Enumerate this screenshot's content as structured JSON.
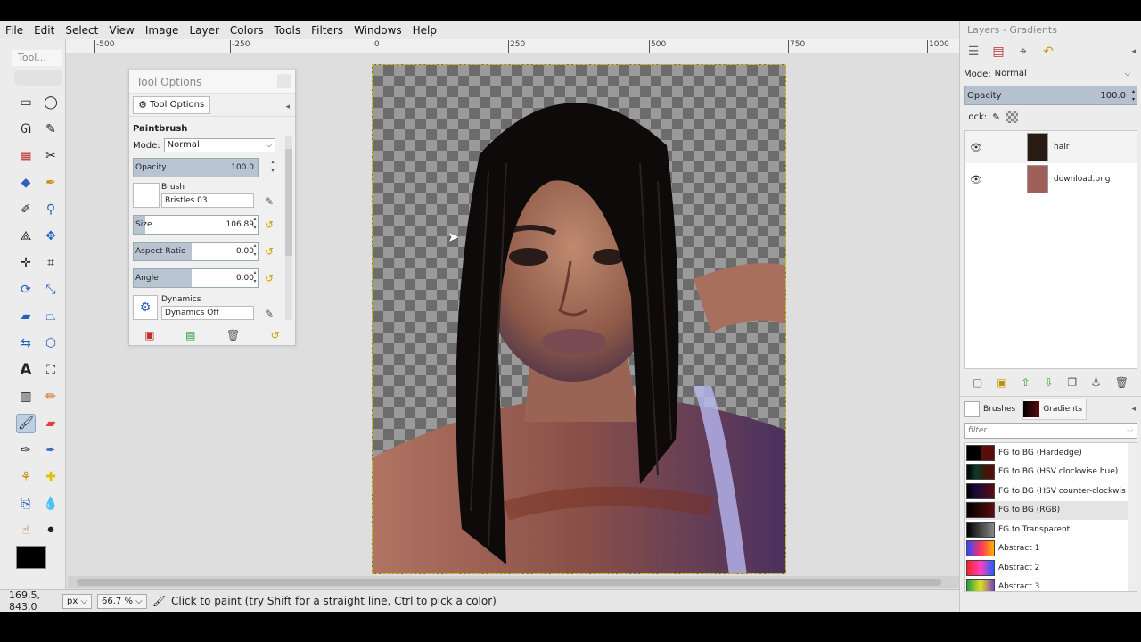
{
  "menubar": {
    "items": [
      "File",
      "Edit",
      "Select",
      "View",
      "Image",
      "Layer",
      "Colors",
      "Tools",
      "Filters",
      "Windows",
      "Help"
    ]
  },
  "toolbox": {
    "title": "Tool...",
    "fg_color": "#000000",
    "bg_color": "#5a0d0d"
  },
  "ruler": {
    "labels": [
      "-500",
      "-250",
      "0",
      "250",
      "500",
      "750",
      "1000"
    ]
  },
  "tool_options": {
    "title": "Tool Options",
    "tab_label": "Tool Options",
    "tool_name": "Paintbrush",
    "mode_label": "Mode:",
    "mode_value": "Normal",
    "opacity_label": "Opacity",
    "opacity_value": "100.0",
    "brush_label": "Brush",
    "brush_value": "Bristles 03",
    "size_label": "Size",
    "size_value": "106.89",
    "aspect_label": "Aspect Ratio",
    "aspect_value": "0.00",
    "angle_label": "Angle",
    "angle_value": "0.00",
    "dynamics_label": "Dynamics",
    "dynamics_value": "Dynamics Off"
  },
  "layers_dock": {
    "title": "Layers - Gradients",
    "mode_label": "Mode:",
    "mode_value": "Normal",
    "opacity_label": "Opacity",
    "opacity_value": "100.0",
    "lock_label": "Lock:",
    "layers": [
      {
        "name": "hair",
        "thumb_color": "#2a1a14"
      },
      {
        "name": "download.png",
        "thumb_color": "#a0605a"
      }
    ]
  },
  "gradients_dock": {
    "tabs": [
      "Brushes",
      "Gradients"
    ],
    "filter_placeholder": "filter",
    "items": [
      {
        "name": "FG to BG (Hardedge)",
        "swatch": "linear-gradient(90deg,#000 50%,#5a0d0d 50%)"
      },
      {
        "name": "FG to BG (HSV clockwise hue)",
        "swatch": "linear-gradient(90deg,#000,#0a3a2a,#3a1a0a,#5a0d0d)"
      },
      {
        "name": "FG to BG (HSV counter-clockwis",
        "swatch": "linear-gradient(90deg,#000,#1a0a3a,#3a0a2a,#5a0d0d)"
      },
      {
        "name": "FG to BG (RGB)",
        "swatch": "linear-gradient(90deg,#000,#5a0d0d)"
      },
      {
        "name": "FG to Transparent",
        "swatch": "linear-gradient(90deg,#000,#888)"
      },
      {
        "name": "Abstract 1",
        "swatch": "linear-gradient(90deg,#2a4cff,#ff3060,#ffb000)"
      },
      {
        "name": "Abstract 2",
        "swatch": "linear-gradient(90deg,#ff2020,#ff40c0,#2060ff)"
      },
      {
        "name": "Abstract 3",
        "swatch": "linear-gradient(90deg,#20a040,#e0e020,#8040c0)"
      }
    ]
  },
  "statusbar": {
    "coords": "169.5, 843.0",
    "unit": "px",
    "zoom": "66.7 %",
    "message": "Click to paint (try Shift for a straight line, Ctrl to pick a color)"
  }
}
